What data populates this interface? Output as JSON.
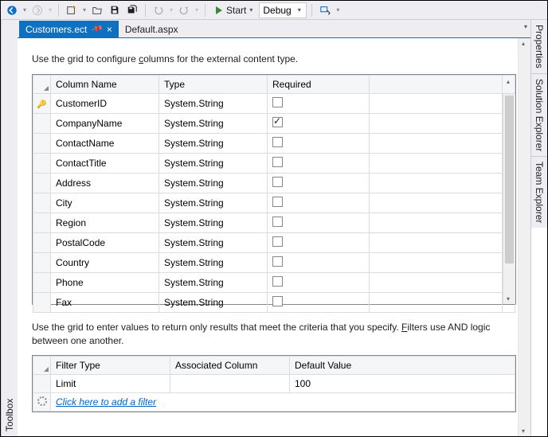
{
  "toolbar": {
    "start_label": "Start",
    "config_selected": "Debug"
  },
  "panels": {
    "left_toolbox": "Toolbox",
    "right_properties": "Properties",
    "right_solution_explorer": "Solution Explorer",
    "right_team_explorer": "Team Explorer"
  },
  "tabs": {
    "active": "Customers.ect",
    "inactive": "Default.aspx"
  },
  "sections": {
    "columns_instr_a": "Use the grid to configure ",
    "columns_instr_b": "olumns for the external content type.",
    "columns_mnemonic": "c",
    "filters_instr_a": "Use the grid to enter values to return only results that meet the criteria that you specify. ",
    "filters_instr_b": "ilters use AND logic between one another.",
    "filters_mnemonic": "F"
  },
  "columns_grid": {
    "headers": {
      "name": "Column Name",
      "type": "Type",
      "required": "Required"
    },
    "rows": [
      {
        "key": true,
        "name": "CustomerID",
        "type": "System.String",
        "required": false
      },
      {
        "key": false,
        "name": "CompanyName",
        "type": "System.String",
        "required": true
      },
      {
        "key": false,
        "name": "ContactName",
        "type": "System.String",
        "required": false
      },
      {
        "key": false,
        "name": "ContactTitle",
        "type": "System.String",
        "required": false
      },
      {
        "key": false,
        "name": "Address",
        "type": "System.String",
        "required": false
      },
      {
        "key": false,
        "name": "City",
        "type": "System.String",
        "required": false
      },
      {
        "key": false,
        "name": "Region",
        "type": "System.String",
        "required": false
      },
      {
        "key": false,
        "name": "PostalCode",
        "type": "System.String",
        "required": false
      },
      {
        "key": false,
        "name": "Country",
        "type": "System.String",
        "required": false
      },
      {
        "key": false,
        "name": "Phone",
        "type": "System.String",
        "required": false
      },
      {
        "key": false,
        "name": "Fax",
        "type": "System.String",
        "required": false
      }
    ]
  },
  "filters_grid": {
    "headers": {
      "type": "Filter Type",
      "assoc": "Associated Column",
      "default": "Default Value"
    },
    "rows": [
      {
        "type": "Limit",
        "assoc": "",
        "default": "100"
      }
    ],
    "add_text": "Click here to add a filter"
  }
}
